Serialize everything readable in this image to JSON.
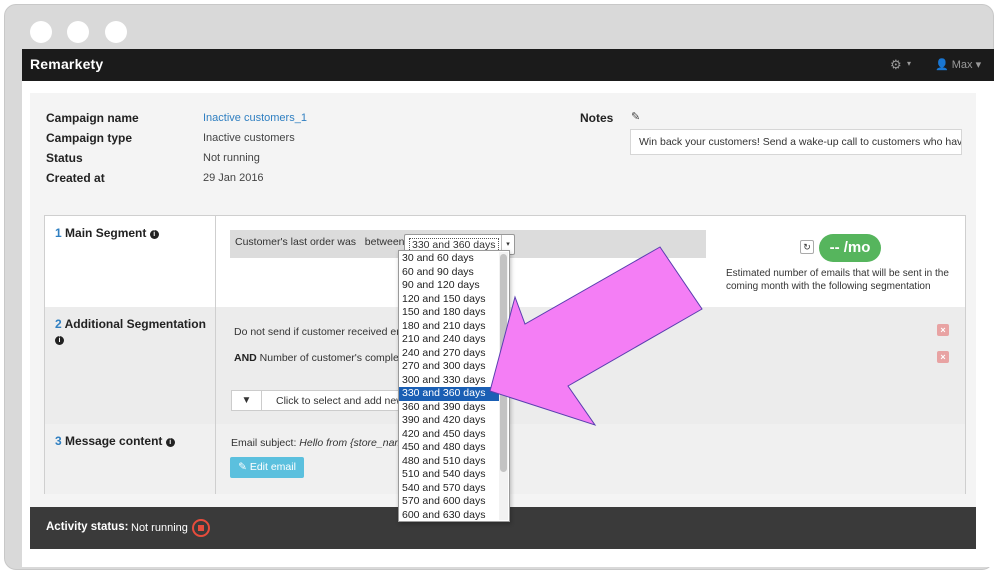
{
  "window": {
    "traffic_lights": [
      "close",
      "minimize",
      "maximize"
    ]
  },
  "topbar": {
    "logo": "Remarkety",
    "settings_icon": "gear-icon",
    "user_icon": "user-icon",
    "user_name": "Max"
  },
  "campaign": {
    "name_label": "Campaign name",
    "name_value": "Inactive customers_1",
    "type_label": "Campaign type",
    "type_value": "Inactive customers",
    "status_label": "Status",
    "status_value": "Not running",
    "created_label": "Created at",
    "created_value": "29 Jan 2016",
    "notes_label": "Notes",
    "notes_edit_icon": "edit-icon",
    "notes_text": "Win back your customers! Send a wake-up call to customers who have..."
  },
  "main_segment": {
    "number": "1",
    "title": "Main Segment",
    "condition_text": "Customer's last order was   between",
    "select_value": "330 and 360 days",
    "estimate_value": "-- /mo",
    "estimate_text": "Estimated number of emails that will be sent in the coming month with the following segmentation"
  },
  "additional": {
    "number": "2",
    "title": "Additional Segmentation",
    "rule1": "Do not send if customer received emai",
    "rule2_prefix": "AND",
    "rule2": "Number of customer's complete",
    "add_condition": "Click to select and add new co",
    "filter_icon": "filter-icon"
  },
  "message": {
    "number": "3",
    "title": "Message content",
    "subject_label": "Email subject:",
    "subject_value": "Hello from {store_name}",
    "edit_button": "Edit email"
  },
  "activity": {
    "label": "Activity status:",
    "value": "Not running"
  },
  "dropdown": {
    "options": [
      "30 and 60 days",
      "60 and 90 days",
      "90 and 120 days",
      "120 and 150 days",
      "150 and 180 days",
      "180 and 210 days",
      "210 and 240 days",
      "240 and 270 days",
      "270 and 300 days",
      "300 and 330 days",
      "330 and 360 days",
      "360 and 390 days",
      "390 and 420 days",
      "420 and 450 days",
      "450 and 480 days",
      "480 and 510 days",
      "510 and 540 days",
      "540 and 570 days",
      "570 and 600 days",
      "600 and 630 days"
    ],
    "selected": "330 and 360 days"
  },
  "colors": {
    "topbar": "#1b1b1b",
    "accent_link": "#2f7fc1",
    "estimate_pill": "#56b55d",
    "edit_button": "#5bc0de",
    "selected_option": "#1a5fb4",
    "annotation_arrow": "#f47ef5",
    "status_stop": "#e74c3c"
  }
}
